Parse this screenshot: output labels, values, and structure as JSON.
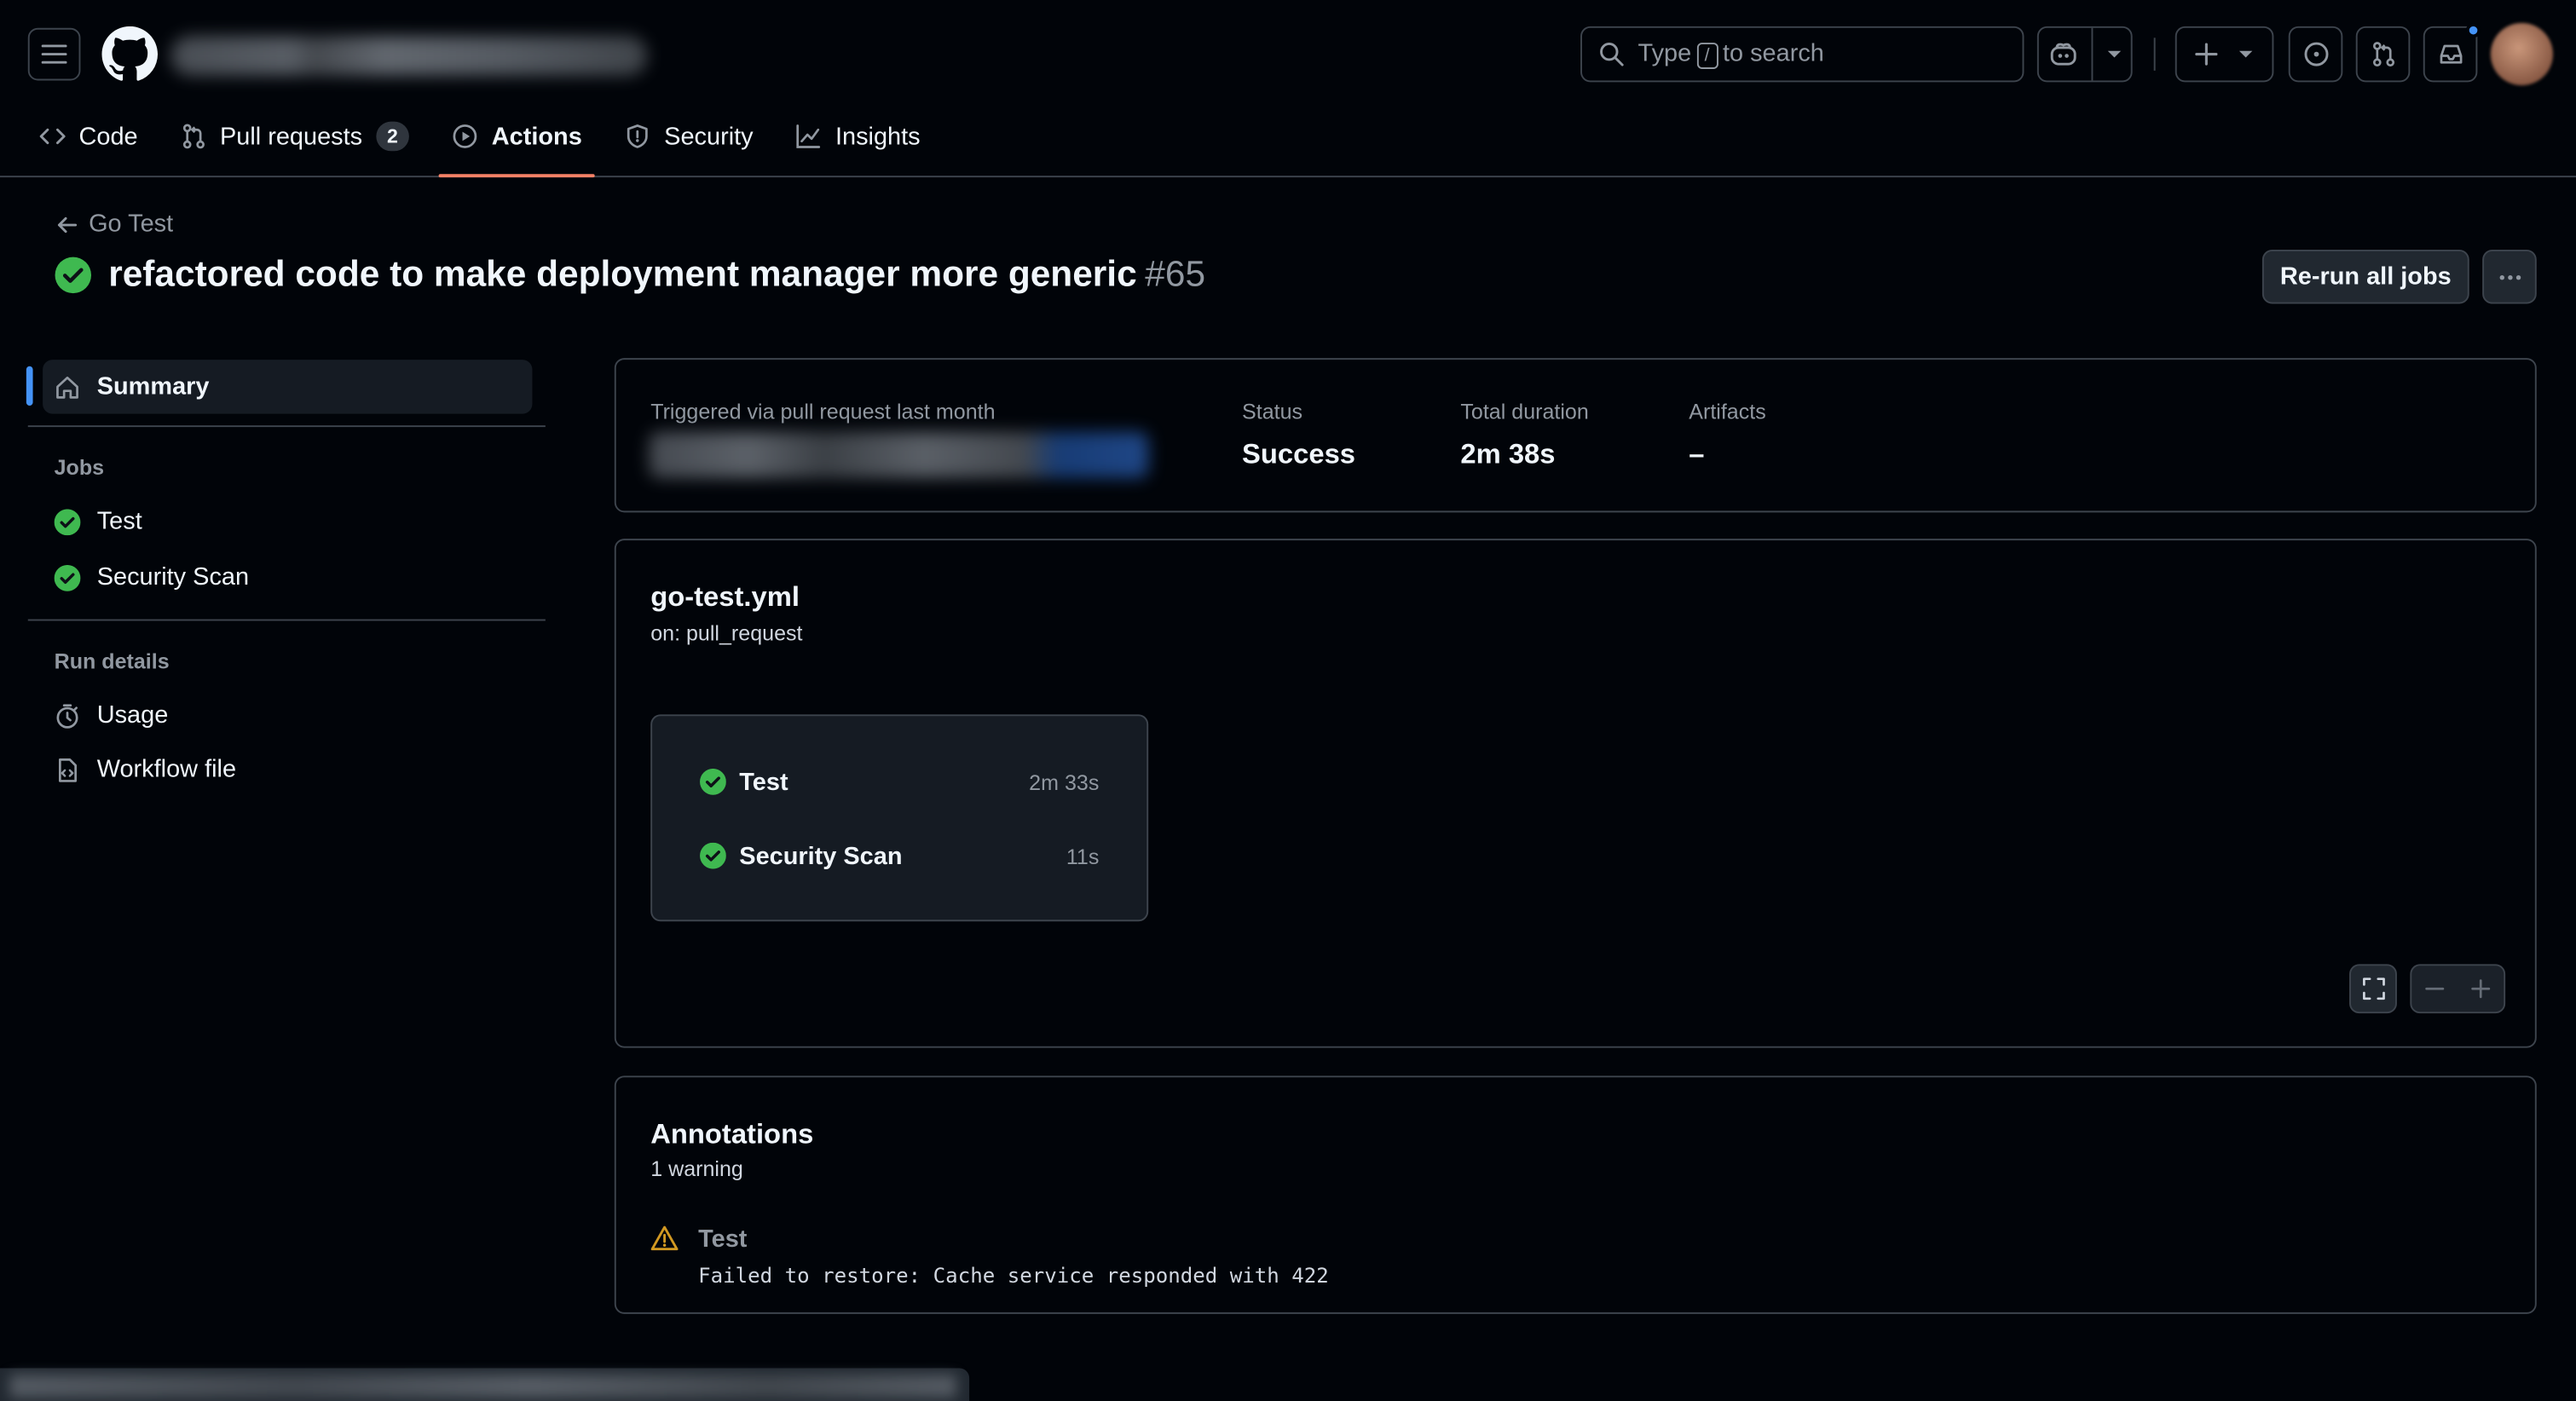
{
  "header": {
    "search_placeholder_prefix": "Type",
    "search_key": "/",
    "search_placeholder_suffix": "to search"
  },
  "tabs": [
    {
      "label": "Code",
      "icon": "code-icon"
    },
    {
      "label": "Pull requests",
      "icon": "git-pull-request-icon",
      "count": "2"
    },
    {
      "label": "Actions",
      "icon": "play-icon",
      "active": true
    },
    {
      "label": "Security",
      "icon": "shield-icon"
    },
    {
      "label": "Insights",
      "icon": "graph-icon"
    }
  ],
  "page": {
    "back_label": "Go Test",
    "title": "refactored code to make deployment manager more generic",
    "run_number": "#65",
    "rerun_label": "Re-run all jobs"
  },
  "sidebar": {
    "summary_label": "Summary",
    "jobs_heading": "Jobs",
    "jobs": [
      "Test",
      "Security Scan"
    ],
    "run_details_heading": "Run details",
    "run_details": [
      {
        "label": "Usage",
        "icon": "stopwatch-icon"
      },
      {
        "label": "Workflow file",
        "icon": "file-code-icon"
      }
    ]
  },
  "summary": {
    "trigger_label": "Triggered via pull request last month",
    "status_label": "Status",
    "status_value": "Success",
    "duration_label": "Total duration",
    "duration_value": "2m 38s",
    "artifacts_label": "Artifacts",
    "artifacts_value": "–"
  },
  "workflow": {
    "file": "go-test.yml",
    "event": "on: pull_request",
    "jobs": [
      {
        "name": "Test",
        "duration": "2m 33s"
      },
      {
        "name": "Security Scan",
        "duration": "11s"
      }
    ]
  },
  "annotations": {
    "title": "Annotations",
    "subtitle": "1 warning",
    "items": [
      {
        "job": "Test",
        "message": "Failed to restore: Cache service responded with 422",
        "level": "warning"
      }
    ]
  },
  "colors": {
    "success": "#3fb950",
    "warning": "#d29922",
    "accent": "#4493f8",
    "active_tab_underline": "#f78166"
  }
}
